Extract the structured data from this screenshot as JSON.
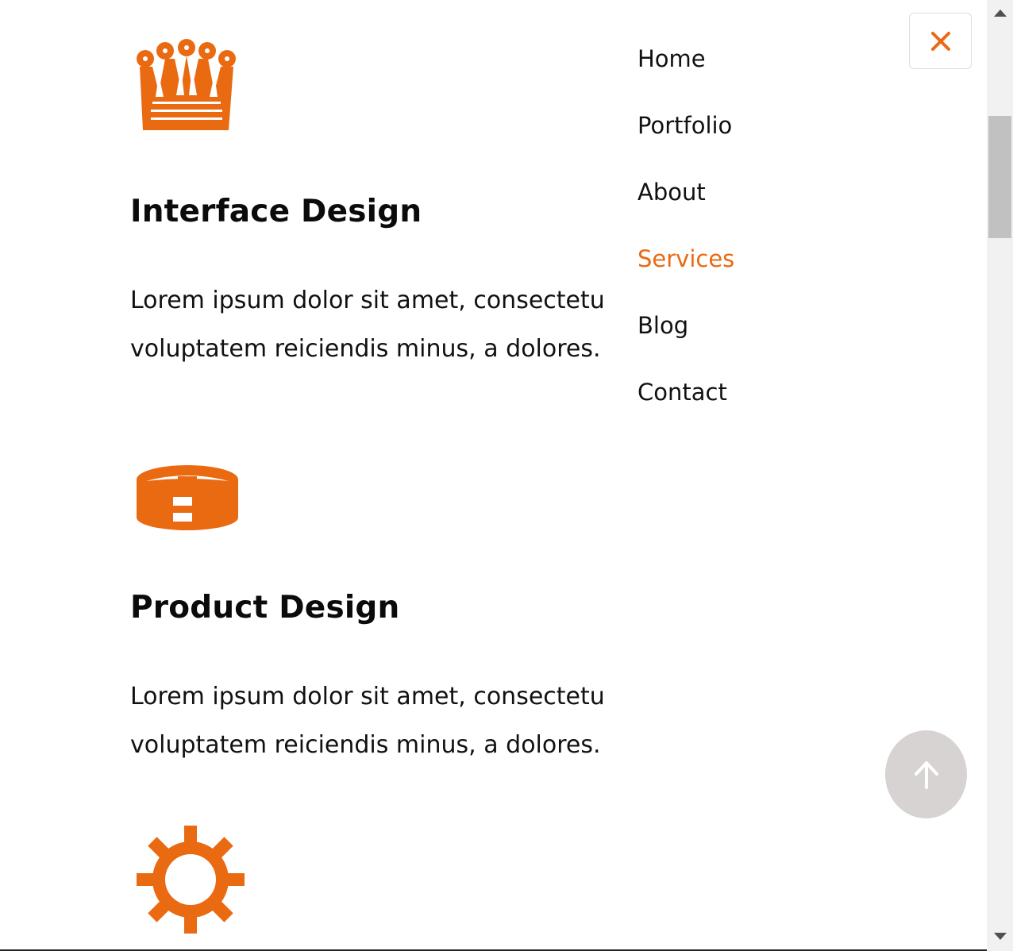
{
  "colors": {
    "accent": "#ea6a12",
    "text": "#111111",
    "top_button_bg": "#d6d3d2",
    "scrollbar_track": "#f1f1f1",
    "scrollbar_thumb": "#c1c1c1"
  },
  "services": [
    {
      "icon": "crown-icon",
      "title": "Interface Design",
      "text_line_1": "Lorem ipsum dolor sit amet, consectetur",
      "text_line_2": "voluptatem reiciendis minus, a dolores."
    },
    {
      "icon": "hockey-puck-icon",
      "title": "Product Design",
      "text_line_1": "Lorem ipsum dolor sit amet, consectetur",
      "text_line_2": "voluptatem reiciendis minus, a dolores."
    },
    {
      "icon": "gear-icon"
    }
  ],
  "nav": {
    "items": [
      {
        "label": "Home"
      },
      {
        "label": "Portfolio"
      },
      {
        "label": "About"
      },
      {
        "label": "Services",
        "active": true
      },
      {
        "label": "Blog"
      },
      {
        "label": "Contact"
      }
    ]
  },
  "controls": {
    "close_icon": "close-icon",
    "back_to_top_icon": "arrow-up-icon"
  }
}
